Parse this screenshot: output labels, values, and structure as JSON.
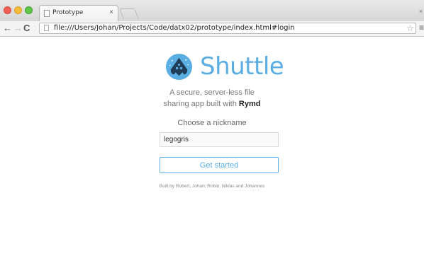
{
  "browser": {
    "tab_title": "Prototype",
    "tab_close": "×",
    "window_close": "×",
    "url": "file:///Users/Johan/Projects/Code/datx02/prototype/index.html#login",
    "nav": {
      "back": "←",
      "forward": "→",
      "reload": "C",
      "bookmark": "☆",
      "menu": "≡"
    }
  },
  "page": {
    "brand": "Shuttle",
    "tagline_line1": "A secure, server-less file",
    "tagline_line2_prefix": "sharing app built with ",
    "tagline_line2_link": "Rymd",
    "nickname_label": "Choose a nickname",
    "nickname_value": "legogris",
    "start_button": "Get started",
    "credits": "Built by Robert, Johan, Robin, Niklas and Johannes"
  },
  "colors": {
    "accent": "#5aaee3",
    "logo_dark": "#1f3d57"
  },
  "icons": [
    "page-icon",
    "star-icon",
    "menu-icon",
    "shuttle-logo-icon"
  ]
}
